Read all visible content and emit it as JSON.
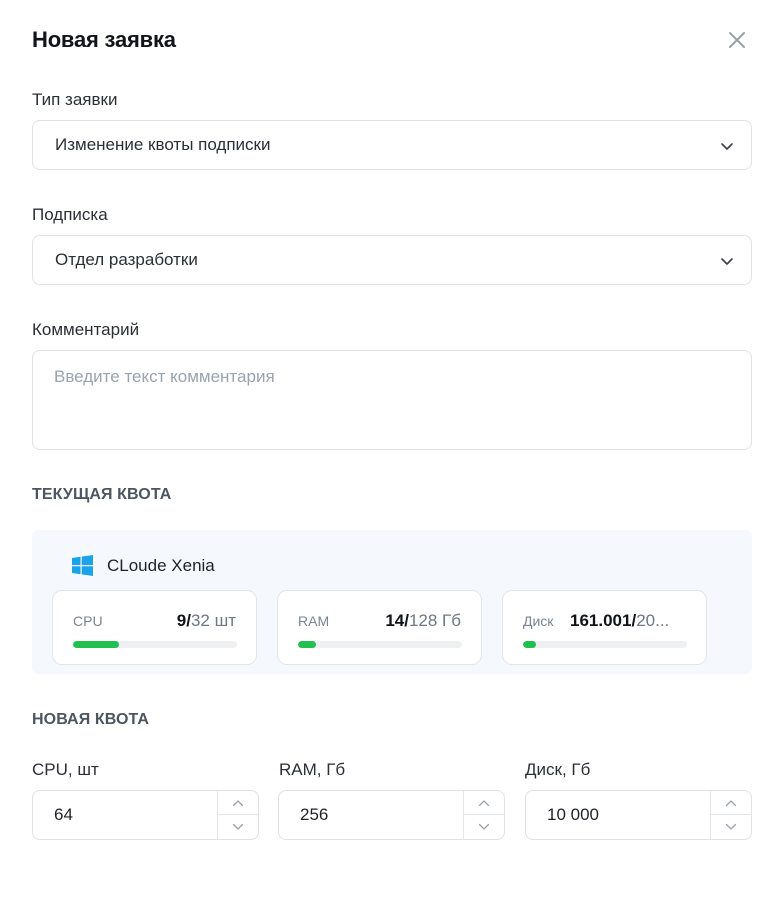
{
  "dialog": {
    "title": "Новая заявка"
  },
  "request_type": {
    "label": "Тип заявки",
    "value": "Изменение квоты подписки"
  },
  "subscription": {
    "label": "Подписка",
    "value": "Отдел разработки"
  },
  "comment": {
    "label": "Комментарий",
    "placeholder": "Введите текст комментария",
    "value": ""
  },
  "current_quota": {
    "heading": "ТЕКУЩАЯ КВОТА",
    "cloud_name": "CLoude Xenia",
    "cloud_icon": "windows-icon",
    "cards": [
      {
        "label": "CPU",
        "used": "9/",
        "total": "32 шт",
        "progress": 0.28
      },
      {
        "label": "RAM",
        "used": "14/",
        "total": "128 Гб",
        "progress": 0.11
      },
      {
        "label": "Диск",
        "used": "161.001/",
        "total": "20...",
        "progress": 0.08
      }
    ],
    "progress_color": "#22c04f"
  },
  "new_quota": {
    "heading": "НОВАЯ КВОТА",
    "fields": [
      {
        "label": "CPU, шт",
        "value": "64"
      },
      {
        "label": "RAM, Гб",
        "value": "256"
      },
      {
        "label": "Диск, Гб",
        "value": "10 000"
      }
    ]
  }
}
